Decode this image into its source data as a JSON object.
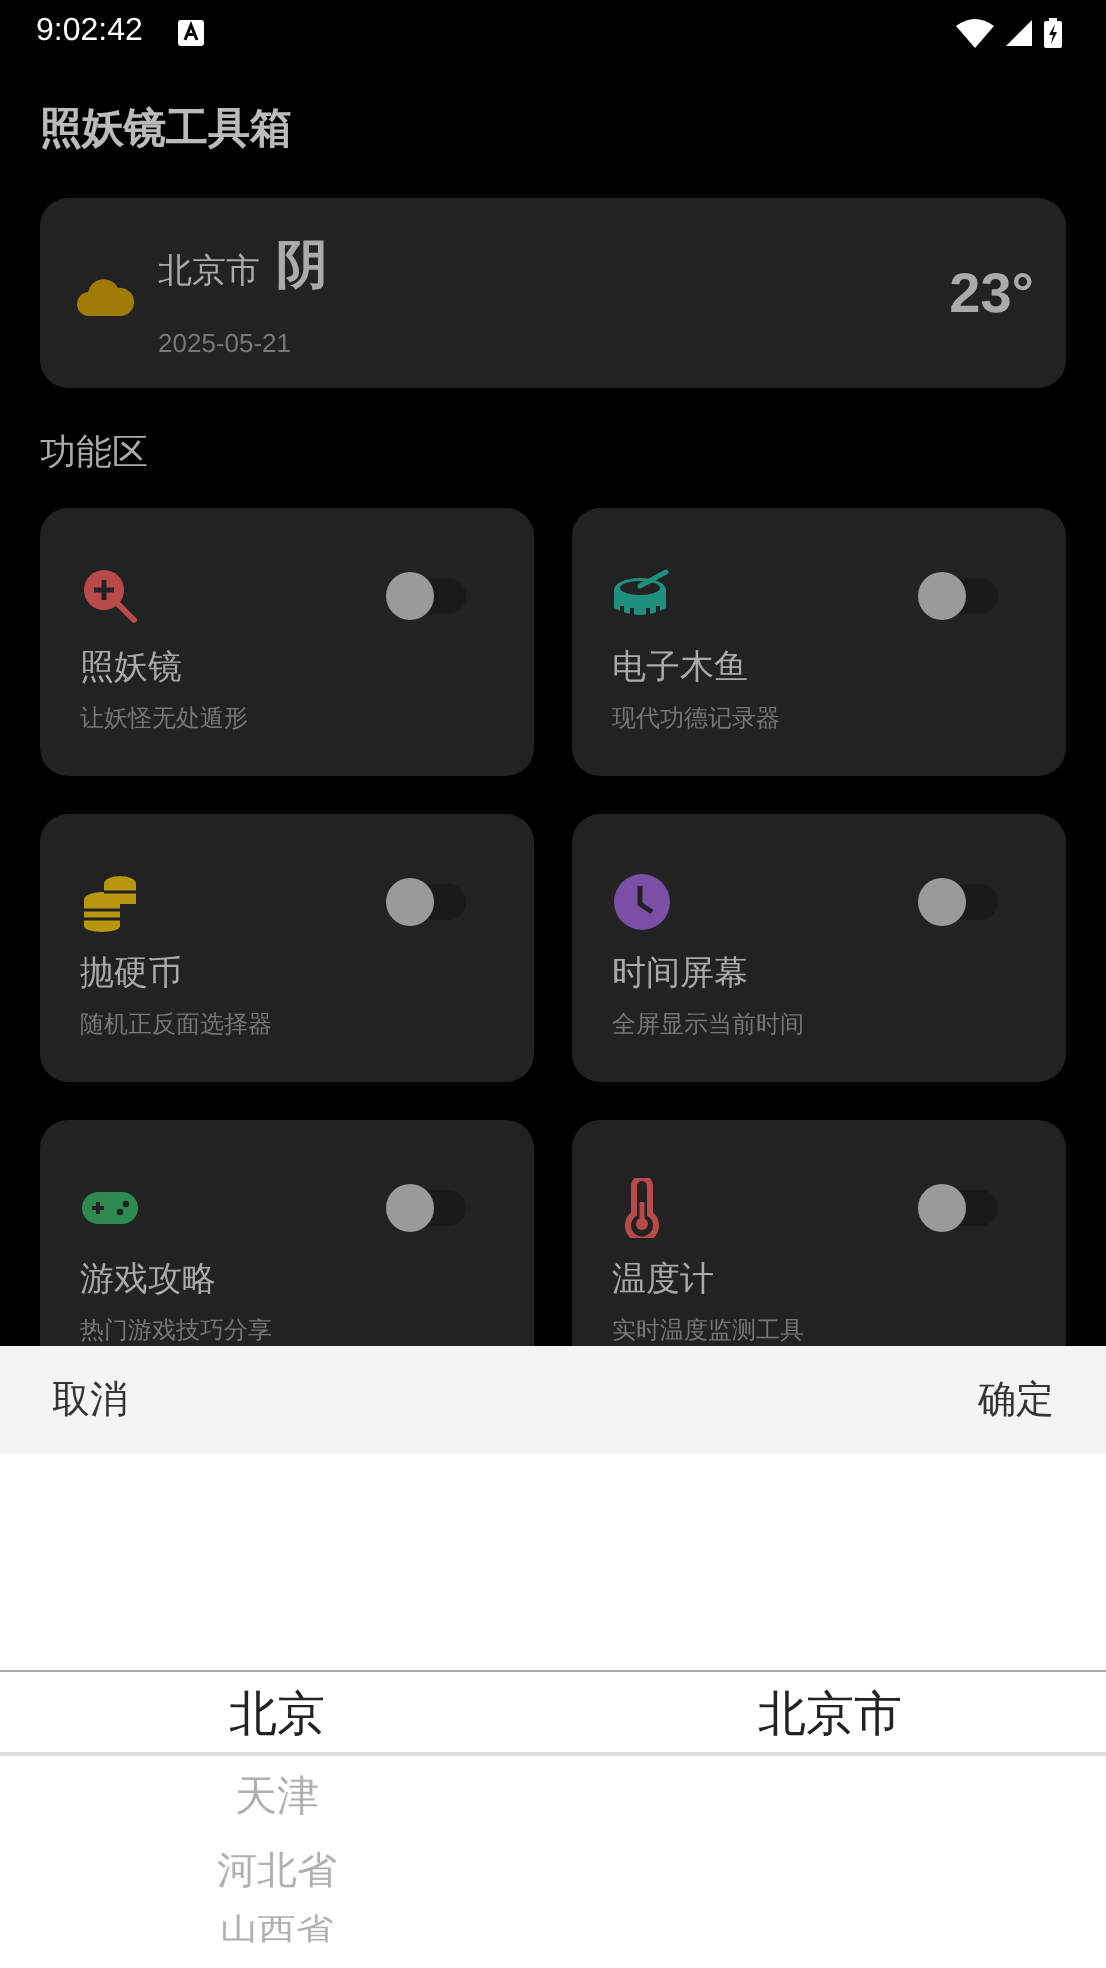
{
  "status_bar": {
    "time": "9:02:42"
  },
  "title": "照妖镜工具箱",
  "weather": {
    "city": "北京市",
    "condition": "阴",
    "date": "2025-05-21",
    "temperature": "23°"
  },
  "section_title": "功能区",
  "tools": [
    {
      "name": "照妖镜",
      "description": "让妖怪无处遁形",
      "kind": "magnifier",
      "color": "#b84a4a",
      "on": false
    },
    {
      "name": "电子木鱼",
      "description": "现代功德记录器",
      "kind": "drum",
      "color": "#1f8f7f",
      "on": false
    },
    {
      "name": "抛硬币",
      "description": "随机正反面选择器",
      "kind": "coins",
      "color": "#b8960f",
      "on": false
    },
    {
      "name": "时间屏幕",
      "description": "全屏显示当前时间",
      "kind": "clock",
      "color": "#7c4fa6",
      "on": false
    },
    {
      "name": "游戏攻略",
      "description": "热门游戏技巧分享",
      "kind": "gamepad",
      "color": "#2e8a4e",
      "on": false
    },
    {
      "name": "温度计",
      "description": "实时温度监测工具",
      "kind": "thermometer",
      "color": "#b84a4a",
      "on": false
    }
  ],
  "picker": {
    "cancel": "取消",
    "confirm": "确定",
    "columns": [
      {
        "items": [
          {
            "label": "北京",
            "selected": true
          },
          {
            "label": "天津",
            "selected": false
          },
          {
            "label": "河北省",
            "selected": false
          },
          {
            "label": "山西省",
            "selected": false
          }
        ]
      },
      {
        "items": [
          {
            "label": "北京市",
            "selected": true
          }
        ]
      }
    ]
  }
}
